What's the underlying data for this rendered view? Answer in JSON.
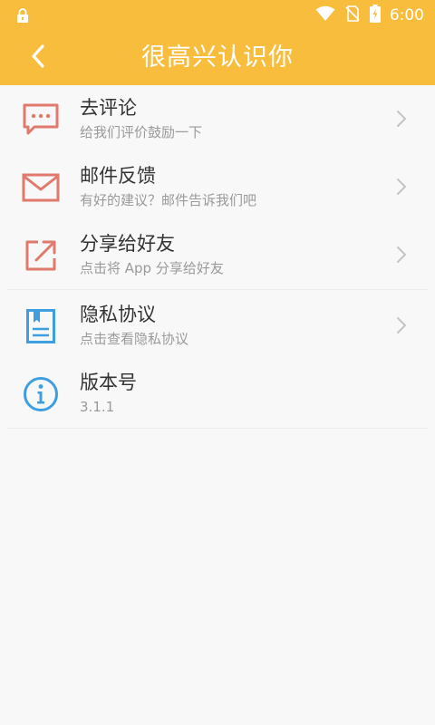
{
  "status": {
    "time": "6:00",
    "icons": [
      "lock-icon",
      "wifi-icon",
      "sim-off-icon",
      "battery-charging-icon"
    ]
  },
  "header": {
    "title": "很高兴认识你",
    "back_icon": "chevron-left-icon",
    "background": "#f9bd3e"
  },
  "items": [
    {
      "title": "去评论",
      "subtitle": "给我们评价鼓励一下",
      "icon": "comment-icon",
      "icon_color": "#e07a6c"
    },
    {
      "title": "邮件反馈",
      "subtitle": "有好的建议？邮件告诉我们吧",
      "icon": "mail-icon",
      "icon_color": "#e07a6c"
    },
    {
      "title": "分享给好友",
      "subtitle": "点击将 App 分享给好友",
      "icon": "share-icon",
      "icon_color": "#e07a6c"
    },
    {
      "title": "隐私协议",
      "subtitle": "点击查看隐私协议",
      "icon": "document-icon",
      "icon_color": "#3d9fe0"
    },
    {
      "title": "版本号",
      "subtitle": "3.1.1",
      "icon": "info-icon",
      "icon_color": "#3d9fe0"
    }
  ]
}
